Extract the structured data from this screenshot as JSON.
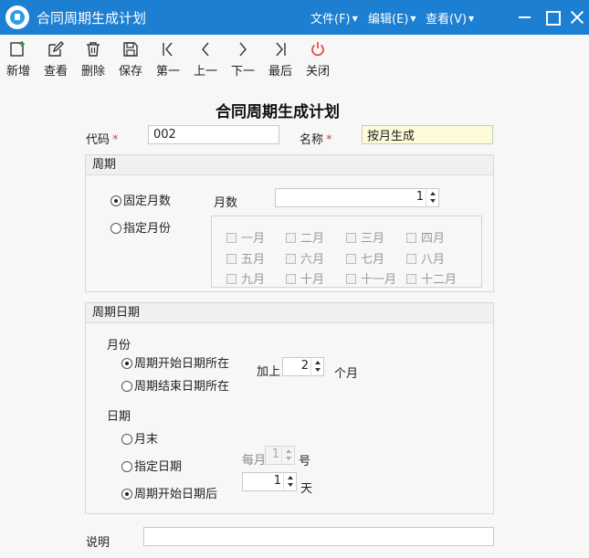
{
  "window": {
    "title": "合同周期生成计划"
  },
  "menu": [
    {
      "label": "文件(F)"
    },
    {
      "label": "编辑(E)"
    },
    {
      "label": "查看(V)"
    }
  ],
  "toolbar": {
    "new_label": "新增",
    "view_label": "查看",
    "delete_label": "删除",
    "save_label": "保存",
    "first_label": "第一",
    "prev_label": "上一",
    "next_label": "下一",
    "last_label": "最后",
    "close_label": "关闭"
  },
  "form": {
    "title": "合同周期生成计划",
    "code_label": "代码",
    "code_value": "002",
    "name_label": "名称",
    "name_value": "按月生成",
    "required_mark": "*"
  },
  "period": {
    "header": "周期",
    "fixed_month_label": "固定月数",
    "fixed_month_selected": true,
    "specific_month_label": "指定月份",
    "specific_month_selected": false,
    "month_count_label": "月数",
    "month_count_value": "1",
    "months": [
      "一月",
      "二月",
      "三月",
      "四月",
      "五月",
      "六月",
      "七月",
      "八月",
      "九月",
      "十月",
      "十一月",
      "十二月"
    ]
  },
  "period_date": {
    "header": "周期日期",
    "month_section_label": "月份",
    "start_month_label": "周期开始日期所在",
    "start_month_selected": true,
    "end_month_label": "周期结束日期所在",
    "end_month_selected": false,
    "add_label": "加上",
    "add_value": "2",
    "months_unit": "个月",
    "day_section_label": "日期",
    "month_end_label": "月末",
    "month_end_selected": false,
    "specific_date_label": "指定日期",
    "specific_date_selected": false,
    "after_start_label": "周期开始日期后",
    "after_start_selected": true,
    "each_month_label": "每月",
    "each_month_value": "1",
    "day_number_unit": "号",
    "days_value": "1",
    "days_unit": "天"
  },
  "description": {
    "label": "说明",
    "value": ""
  },
  "colors": {
    "titlebar": "#1c7fd2",
    "close_icon": "#e53935",
    "required": "#e53935",
    "name_field_bg": "#fdfbd8"
  }
}
